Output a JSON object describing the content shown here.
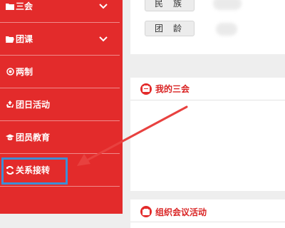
{
  "sidebar": {
    "items": [
      {
        "label": "三会",
        "icon": "folder-icon",
        "expandable": true
      },
      {
        "label": "团课",
        "icon": "folder-open-icon",
        "expandable": true
      },
      {
        "label": "两制",
        "icon": "target-icon",
        "expandable": false
      },
      {
        "label": "团日活动",
        "icon": "recycle-icon",
        "expandable": false
      },
      {
        "label": "团员教育",
        "icon": "graduation-cap-icon",
        "expandable": false
      },
      {
        "label": "关系接转",
        "icon": "refresh-icon",
        "expandable": false,
        "highlighted": true
      }
    ]
  },
  "profile": {
    "fields": [
      {
        "label": "民族"
      },
      {
        "label": "团龄"
      }
    ]
  },
  "cards": {
    "my_meetings": {
      "title": "我的三会"
    },
    "org_meetings": {
      "title": "组织会议活动"
    }
  },
  "colors": {
    "sidebar_bg": "#e32b2b",
    "accent_red": "#d92323",
    "highlight_border": "#3c8fd6",
    "annotation_arrow": "#e8413f"
  }
}
